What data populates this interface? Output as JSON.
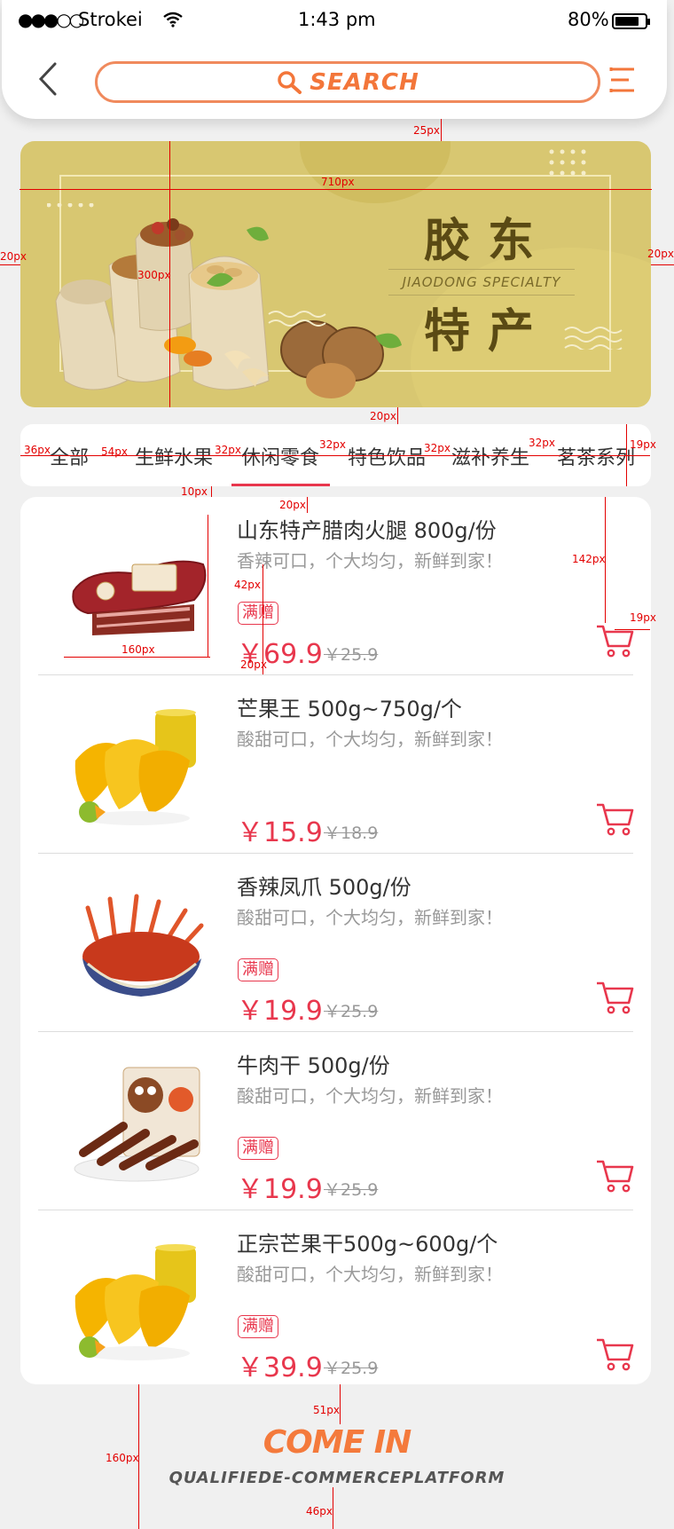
{
  "status_bar": {
    "signal": "●●●○○",
    "carrier": "Strokei",
    "time": "1:43 pm",
    "battery_percent": "80%",
    "battery_level": 0.8
  },
  "header": {
    "search_label": "SEARCH",
    "back_icon": "chevron-left-icon",
    "menu_icon": "menu-icon"
  },
  "banner": {
    "title_line1": "胶东",
    "title_line2": "特产",
    "subtitle": "JIAODONG SPECIALTY"
  },
  "tabs": [
    {
      "label": "全部"
    },
    {
      "label": "生鲜水果"
    },
    {
      "label": "休闲零食",
      "active": true
    },
    {
      "label": "特色饮品"
    },
    {
      "label": "滋补养生"
    },
    {
      "label": "茗茶系列"
    }
  ],
  "products": [
    {
      "name": "山东特产腊肉火腿 800g/份",
      "desc": "香辣可口，个大均匀，新鲜到家！",
      "tag": "满赠",
      "price": "￥69.9",
      "old_price": "￥25.9"
    },
    {
      "name": "芒果王 500g~750g/个",
      "desc": "酸甜可口，个大均匀，新鲜到家！",
      "tag": "",
      "price": "￥15.9",
      "old_price": "￥18.9"
    },
    {
      "name": "香辣凤爪 500g/份",
      "desc": "酸甜可口，个大均匀，新鲜到家！",
      "tag": "满赠",
      "price": "￥19.9",
      "old_price": "￥25.9"
    },
    {
      "name": "牛肉干 500g/份",
      "desc": "酸甜可口，个大均匀，新鲜到家！",
      "tag": "满赠",
      "price": "￥19.9",
      "old_price": "￥25.9"
    },
    {
      "name": "正宗芒果干500g~600g/个",
      "desc": "酸甜可口，个大均匀，新鲜到家！",
      "tag": "满赠",
      "price": "￥39.9",
      "old_price": "￥25.9"
    }
  ],
  "footer": {
    "title": "COME IN",
    "subtitle": "QUALIFIEDE-COMMERCEPLATFORM"
  },
  "annotations": {
    "a_25": "25px",
    "a_710": "710px",
    "a_20l": "20px",
    "a_20r": "20px",
    "a_300": "300px",
    "a_20b": "20px",
    "a_36": "36px",
    "a_54": "54px",
    "a_32a": "32px",
    "a_32b": "32px",
    "a_32c": "32px",
    "a_32d": "32px",
    "a_19": "19px",
    "a_10": "10px",
    "a_20c": "20px",
    "a_142": "142px",
    "a_42": "42px",
    "a_19b": "19px",
    "a_160w": "160px",
    "a_20d": "20px",
    "a_51": "51px",
    "a_160h": "160px",
    "a_46": "46px"
  },
  "colors": {
    "accent": "#e8374d",
    "search_border": "#f08a5d",
    "banner_bg": "#d8c771",
    "footer_title": "#f47a3c"
  }
}
